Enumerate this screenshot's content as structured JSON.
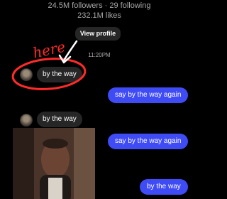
{
  "profile": {
    "followers_line": "24.5M followers · 29 following",
    "likes_line": "232.1M likes",
    "view_profile_label": "View profile"
  },
  "annotation": {
    "text": "here"
  },
  "timestamp": "11:20PM",
  "messages": [
    {
      "side": "in",
      "text": "by the way"
    },
    {
      "side": "out",
      "text": "say by the way again"
    },
    {
      "side": "in",
      "text": "by the way"
    },
    {
      "side": "out",
      "text": "say by the way again"
    },
    {
      "side": "out",
      "text": "by the way"
    }
  ],
  "colors": {
    "background": "#000000",
    "incoming_bubble": "#262626",
    "outgoing_bubble": "#3f4bf5",
    "annotation": "#ff2a2a"
  }
}
